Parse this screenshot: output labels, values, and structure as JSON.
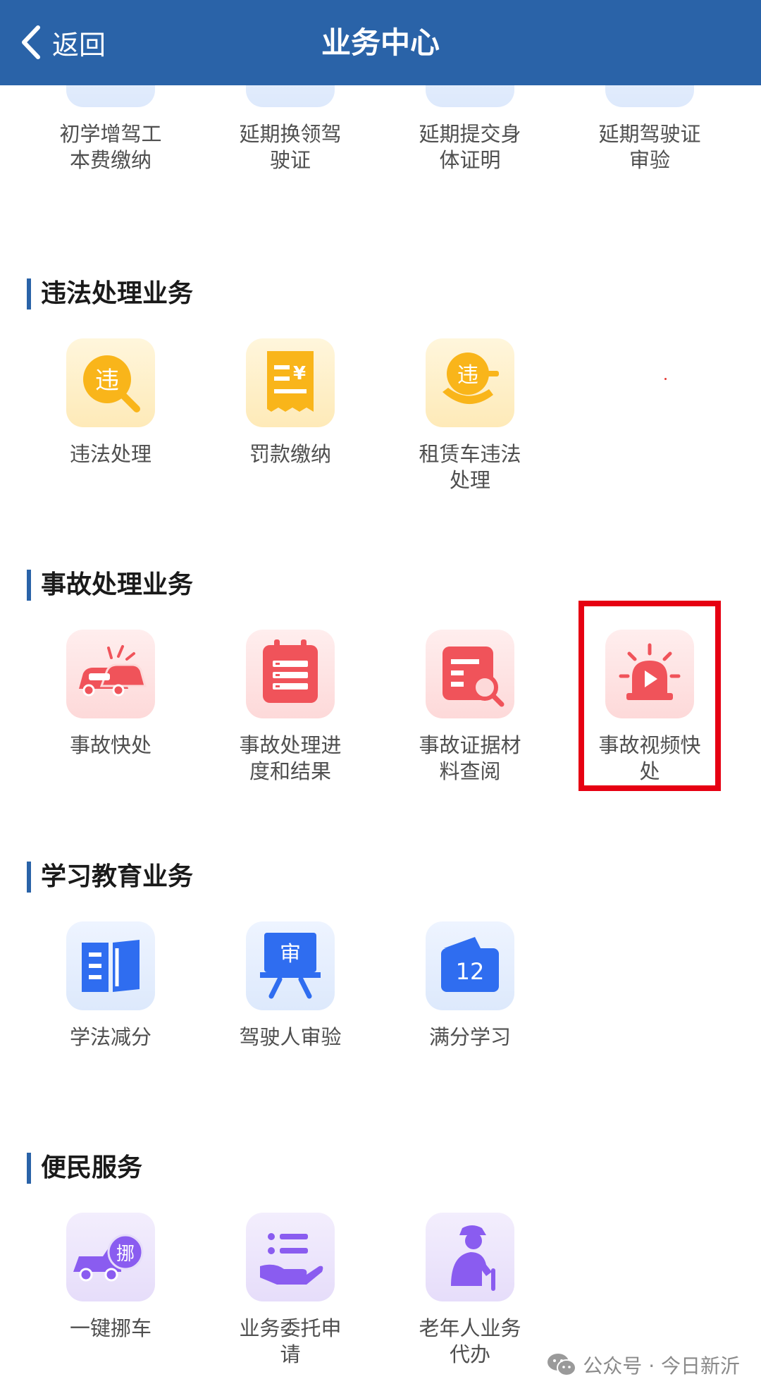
{
  "header": {
    "back_label": "返回",
    "title": "业务中心"
  },
  "sections": {
    "top": {
      "items": [
        {
          "label": "初学增驾工本费缴纳"
        },
        {
          "label": "延期换领驾驶证"
        },
        {
          "label": "延期提交身体证明"
        },
        {
          "label": "延期驾驶证审验"
        }
      ]
    },
    "violation": {
      "title": "违法处理业务",
      "items": [
        {
          "label": "违法处理",
          "icon_text": "违"
        },
        {
          "label": "罚款缴纳"
        },
        {
          "label": "租赁车违法处理",
          "icon_text": "违"
        }
      ]
    },
    "accident": {
      "title": "事故处理业务",
      "items": [
        {
          "label": "事故快处"
        },
        {
          "label": "事故处理进度和结果"
        },
        {
          "label": "事故证据材料查阅"
        },
        {
          "label": "事故视频快处"
        }
      ]
    },
    "study": {
      "title": "学习教育业务",
      "items": [
        {
          "label": "学法减分"
        },
        {
          "label": "驾驶人审验",
          "icon_text": "审"
        },
        {
          "label": "满分学习",
          "icon_text": "12"
        }
      ]
    },
    "convenience": {
      "title": "便民服务",
      "items": [
        {
          "label": "一键挪车",
          "icon_text": "挪"
        },
        {
          "label": "业务委托申请"
        },
        {
          "label": "老年人业务代办"
        }
      ]
    }
  },
  "watermark": {
    "text": "公众号 · 今日新沂"
  },
  "colors": {
    "header_bg": "#2a63a8",
    "highlight": "#e60012",
    "blue_icon": "#2f6df0",
    "yellow_icon": "#f9b51a",
    "red_icon": "#f0535a",
    "purple_icon": "#8a5cf0"
  }
}
